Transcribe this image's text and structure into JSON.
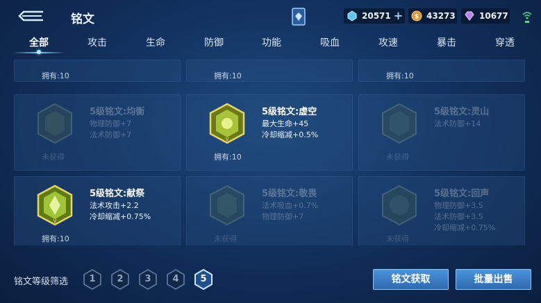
{
  "header": {
    "title": "铭文",
    "currencies": {
      "gem": "20571",
      "gold": "43273",
      "coupon": "10677"
    }
  },
  "tabs": [
    "全部",
    "攻击",
    "生命",
    "防御",
    "功能",
    "吸血",
    "攻速",
    "暴击",
    "穿透"
  ],
  "active_tab_index": 0,
  "partial_row": [
    {
      "owned": "拥有:10"
    },
    {
      "owned": "拥有:10"
    },
    {
      "owned": "拥有:10"
    }
  ],
  "runes": [
    {
      "name": "5级铭文:均衡",
      "attrs": [
        "物理防御+7",
        "法术防御+7"
      ],
      "status": "未获得",
      "owned": false,
      "color": "#7c8a6d"
    },
    {
      "name": "5级铭文:虚空",
      "attrs": [
        "最大生命+45",
        "冷却缩减+0.5%"
      ],
      "status": "拥有:10",
      "owned": true,
      "color": "#a9c23c"
    },
    {
      "name": "5级铭文:灵山",
      "attrs": [
        "法术防御+14"
      ],
      "status": "未获得",
      "owned": false,
      "color": "#6f8a6b"
    },
    {
      "name": "5级铭文:献祭",
      "attrs": [
        "法术攻击+2.2",
        "冷却缩减+0.75%"
      ],
      "status": "拥有:10",
      "owned": true,
      "color": "#9fc43a"
    },
    {
      "name": "5级铭文:敬畏",
      "attrs": [
        "法术吸血+0.7%",
        "物理防御+7"
      ],
      "status": "未获得",
      "owned": false,
      "color": "#7c8a6d"
    },
    {
      "name": "5级铭文:回声",
      "attrs": [
        "物理防御+3.5",
        "法术防御+3.5",
        "冷却缩减+0.75%"
      ],
      "status": "未获得",
      "owned": false,
      "color": "#6f8a6b"
    }
  ],
  "filter": {
    "label": "铭文等级筛选",
    "levels": [
      "1",
      "2",
      "3",
      "4",
      "5"
    ],
    "active_level": "5"
  },
  "buttons": {
    "get": "铭文获取",
    "sell": "批量出售"
  }
}
